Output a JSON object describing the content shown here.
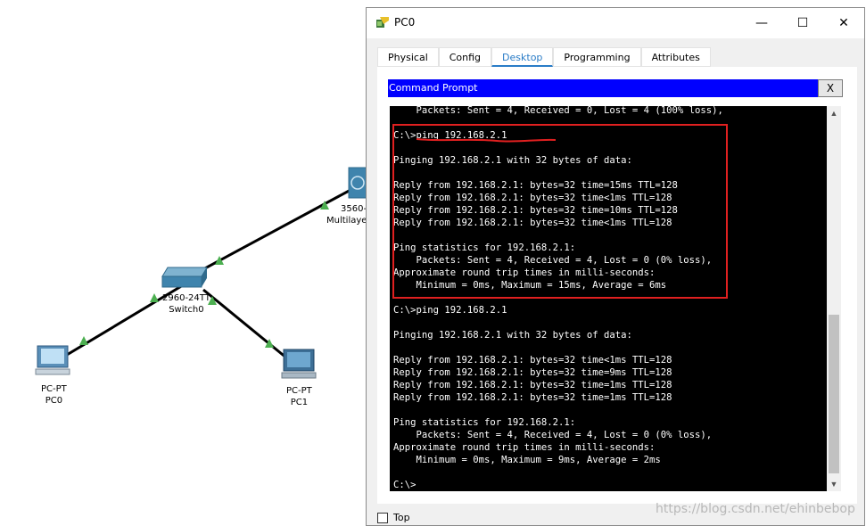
{
  "topology": {
    "nodes": [
      {
        "id": "pc0",
        "model": "PC-PT",
        "name": "PC0"
      },
      {
        "id": "pc1",
        "model": "PC-PT",
        "name": "PC1"
      },
      {
        "id": "switch0",
        "model": "2960-24TT",
        "name": "Switch0"
      },
      {
        "id": "multilayer",
        "model": "3560-",
        "name": "Multilayer"
      }
    ],
    "link_status_color": "#4caf50"
  },
  "window": {
    "title": "PC0",
    "controls": {
      "minimize": "—",
      "maximize": "☐",
      "close": "✕"
    },
    "tabs": [
      {
        "label": "Physical",
        "active": false
      },
      {
        "label": "Config",
        "active": false
      },
      {
        "label": "Desktop",
        "active": true
      },
      {
        "label": "Programming",
        "active": false
      },
      {
        "label": "Attributes",
        "active": false
      }
    ],
    "command_prompt": {
      "title": "Command Prompt",
      "close_label": "X",
      "lines": [
        "    Packets: Sent = 4, Received = 0, Lost = 4 (100% loss),",
        "",
        "C:\\>ping 192.168.2.1",
        "",
        "Pinging 192.168.2.1 with 32 bytes of data:",
        "",
        "Reply from 192.168.2.1: bytes=32 time=15ms TTL=128",
        "Reply from 192.168.2.1: bytes=32 time<1ms TTL=128",
        "Reply from 192.168.2.1: bytes=32 time=10ms TTL=128",
        "Reply from 192.168.2.1: bytes=32 time<1ms TTL=128",
        "",
        "Ping statistics for 192.168.2.1:",
        "    Packets: Sent = 4, Received = 4, Lost = 0 (0% loss),",
        "Approximate round trip times in milli-seconds:",
        "    Minimum = 0ms, Maximum = 15ms, Average = 6ms",
        "",
        "C:\\>ping 192.168.2.1",
        "",
        "Pinging 192.168.2.1 with 32 bytes of data:",
        "",
        "Reply from 192.168.2.1: bytes=32 time<1ms TTL=128",
        "Reply from 192.168.2.1: bytes=32 time=9ms TTL=128",
        "Reply from 192.168.2.1: bytes=32 time=1ms TTL=128",
        "Reply from 192.168.2.1: bytes=32 time=1ms TTL=128",
        "",
        "Ping statistics for 192.168.2.1:",
        "    Packets: Sent = 4, Received = 4, Lost = 0 (0% loss),",
        "Approximate round trip times in milli-seconds:",
        "    Minimum = 0ms, Maximum = 9ms, Average = 2ms",
        "",
        "C:\\>"
      ]
    },
    "top_checkbox": {
      "label": "Top",
      "checked": false
    }
  },
  "watermark": "https://blog.csdn.net/ehinbebop",
  "colors": {
    "accent": "#2a7cc7",
    "cmd_header": "#0000ff",
    "highlight": "#e02020"
  }
}
